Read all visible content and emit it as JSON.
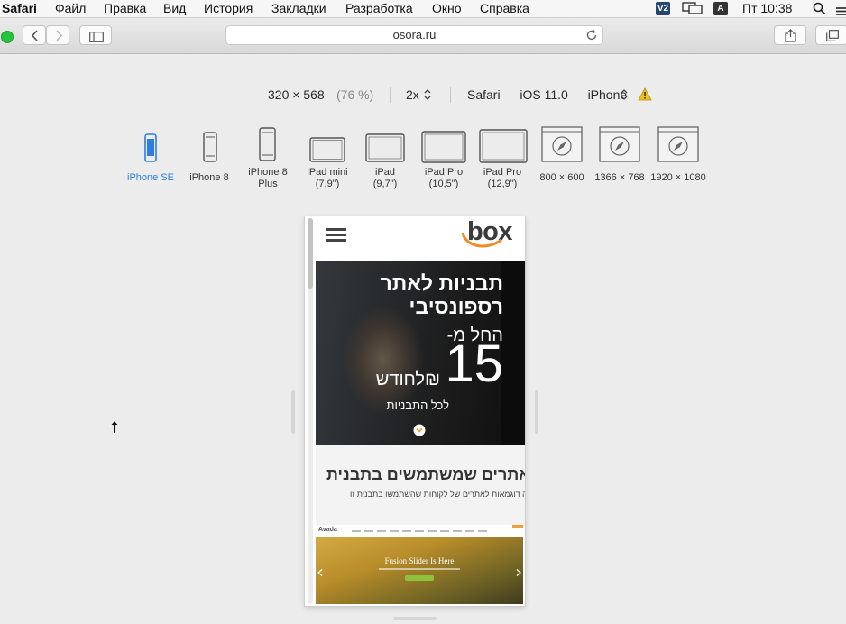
{
  "menubar": {
    "app_name": "Safari",
    "items": [
      "Файл",
      "Правка",
      "Вид",
      "История",
      "Закладки",
      "Разработка",
      "Окно",
      "Справка"
    ],
    "status_badge_v": "V2",
    "status_badge_a": "A",
    "clock": "Пт 10:38"
  },
  "toolbar": {
    "url": "osora.ru"
  },
  "responsive": {
    "size": "320 × 568",
    "scale": "(76 %)",
    "pixel_ratio": "2x",
    "user_agent": "Safari — iOS 11.0 — iPhone",
    "devices": [
      {
        "line1": "iPhone SE",
        "line2": ""
      },
      {
        "line1": "iPhone 8",
        "line2": ""
      },
      {
        "line1": "iPhone 8",
        "line2": "Plus"
      },
      {
        "line1": "iPad mini",
        "line2": "(7,9\")"
      },
      {
        "line1": "iPad",
        "line2": "(9,7\")"
      },
      {
        "line1": "iPad Pro",
        "line2": "(10,5\")"
      },
      {
        "line1": "iPad Pro",
        "line2": "(12,9\")"
      },
      {
        "line1": "800 × 600",
        "line2": ""
      },
      {
        "line1": "1366 × 768",
        "line2": ""
      },
      {
        "line1": "1920 × 1080",
        "line2": ""
      }
    ],
    "selected_device": "iPhone SE"
  },
  "site": {
    "logo": "box",
    "hero_title_1": "תבניות לאתר",
    "hero_title_2": "רספונסיבי",
    "hero_from": "החל מ-",
    "hero_price": "15",
    "hero_per_month": "₪לחודש",
    "hero_all": "לכל התבניות",
    "section_title": "אתרים שמשתמשים בתבנית",
    "section_sub": "כמה דוגמאות לאתרים של לקוחות שהשתמשו בתבנית זו",
    "shot_logo": "Avada",
    "shot_caption": "Fusion Slider Is Here"
  },
  "colors": {
    "accent_blue": "#2f7de1",
    "logo_orange": "#f08a24",
    "logo_dark": "#3a3a3a",
    "hero_text": "#ffffff",
    "chevron_orange": "#f0a13a"
  }
}
